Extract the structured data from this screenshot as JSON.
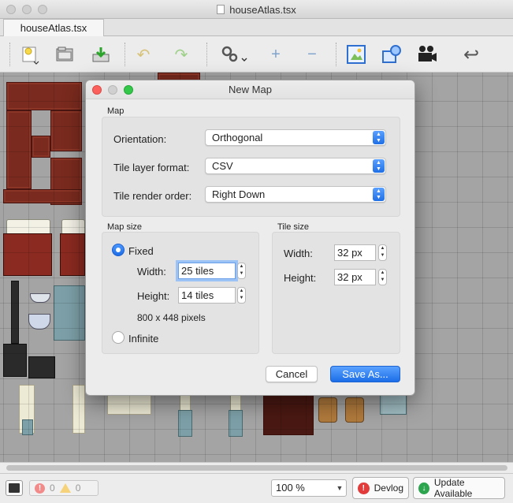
{
  "window": {
    "title": "houseAtlas.tsx",
    "tab_label": "houseAtlas.tsx"
  },
  "toolbar": {
    "icons": [
      "new-map-icon",
      "open-icon",
      "save-icon",
      "undo-icon",
      "redo-icon",
      "settings-icon",
      "add-icon",
      "remove-icon",
      "tileset-image-icon",
      "shape-icon",
      "video-icon",
      "return-icon"
    ]
  },
  "dialog": {
    "title": "New Map",
    "map_group": {
      "label": "Map",
      "orientation_label": "Orientation:",
      "orientation_value": "Orthogonal",
      "layer_format_label": "Tile layer format:",
      "layer_format_value": "CSV",
      "render_order_label": "Tile render order:",
      "render_order_value": "Right Down"
    },
    "map_size": {
      "label": "Map size",
      "fixed_label": "Fixed",
      "width_label": "Width:",
      "width_value": "25 tiles",
      "height_label": "Height:",
      "height_value": "14 tiles",
      "pixels_text": "800 x 448 pixels",
      "infinite_label": "Infinite",
      "mode": "fixed"
    },
    "tile_size": {
      "label": "Tile size",
      "width_label": "Width:",
      "width_value": "32 px",
      "height_label": "Height:",
      "height_value": "32 px"
    },
    "cancel_label": "Cancel",
    "save_label": "Save As..."
  },
  "statusbar": {
    "error_count": "0",
    "warning_count": "0",
    "zoom_value": "100 %",
    "devlog_label": "Devlog",
    "update_label": "Update Available"
  },
  "colors": {
    "accent": "#1f6fe5",
    "brick": "#7a2a1e",
    "canvas_bg": "#a4a4a4"
  }
}
